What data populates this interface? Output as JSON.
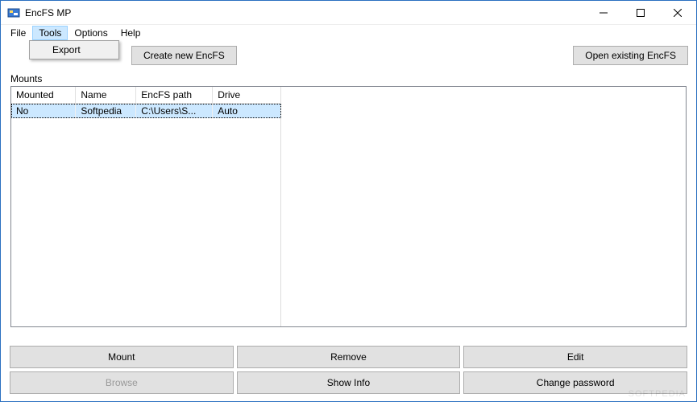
{
  "window": {
    "title": "EncFS MP"
  },
  "menu": {
    "file": "File",
    "tools": "Tools",
    "options": "Options",
    "help": "Help",
    "tools_dropdown": {
      "export": "Export"
    }
  },
  "toolbar": {
    "create": "Create new EncFS",
    "open": "Open existing EncFS"
  },
  "section": {
    "mounts": "Mounts"
  },
  "table": {
    "headers": {
      "mounted": "Mounted",
      "name": "Name",
      "path": "EncFS path",
      "drive": "Drive"
    },
    "rows": [
      {
        "mounted": "No",
        "name": "Softpedia",
        "path": "C:\\Users\\S...",
        "drive": "Auto"
      }
    ]
  },
  "buttons": {
    "mount": "Mount",
    "remove": "Remove",
    "edit": "Edit",
    "browse": "Browse",
    "showinfo": "Show Info",
    "changepw": "Change password"
  },
  "watermark": "SOFTPEDIA"
}
